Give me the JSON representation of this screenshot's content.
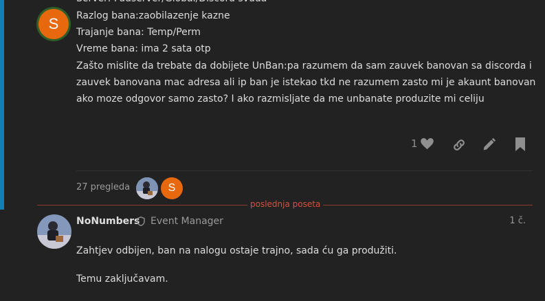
{
  "first_post": {
    "avatar_letter": "S",
    "avatar_color": "#e8690d",
    "lines": [
      "Server: Fudserver/Global/Discord svuda",
      "Razlog bana:zaobilazenje kazne",
      "Trajanje bana: Temp/Perm",
      "Vreme bana: ima 2 sata otp",
      "Zašto mislite da trebate da dobijete UnBan:pa razumem da sam zauvek banovan sa discorda i",
      "zauvek banovana mac adresa ali ip ban je istekao tkd ne razumem zasto mi je akaunt banovan",
      "ako moze odgovor samo zasto? I ako razmisljate da me unbanate produzite mi celiju"
    ],
    "like_count": "1",
    "icons": [
      "heart-icon",
      "link-icon",
      "pencil-icon",
      "bookmark-icon"
    ]
  },
  "topic_meta": {
    "views_text": "27 pregleda",
    "participant_letter": "S",
    "participant_color": "#e8690d"
  },
  "new_posts_label": "poslednja poseta",
  "reply": {
    "username": "NoNumbers",
    "user_title": "Event Manager",
    "date": "1 č.",
    "paragraphs": [
      "Zahtjev odbijen, ban na nalogu ostaje trajno, sada ću ga produžiti.",
      "Temu zaključavam."
    ]
  },
  "colors": {
    "accent_blue": "#0f82af",
    "new_line": "#8e3a2c",
    "new_label": "#d0543e",
    "background": "#222222"
  }
}
